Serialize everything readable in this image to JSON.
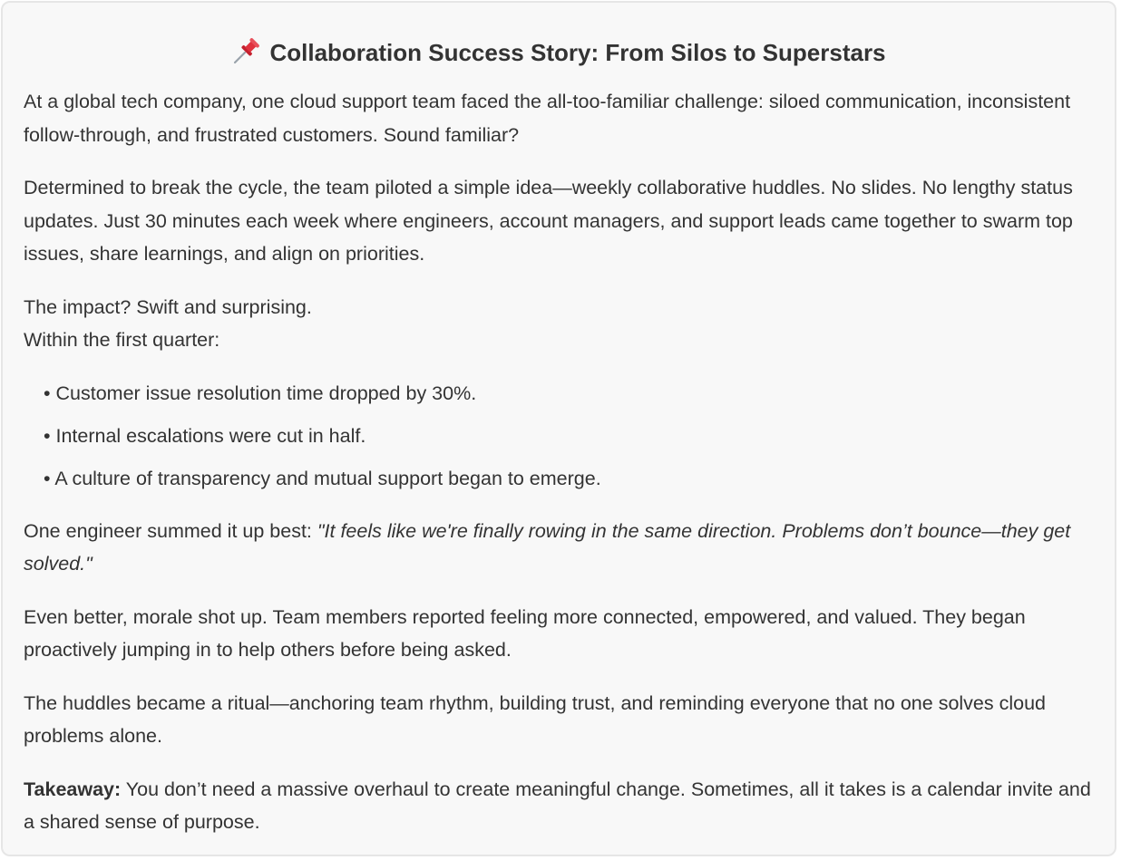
{
  "title": {
    "emoji_icon": "pushpin-icon",
    "text": "Collaboration Success Story: From Silos to Superstars"
  },
  "paragraphs": {
    "intro": "At a global tech company, one cloud support team faced the all-too-familiar challenge: siloed communication, inconsistent follow-through, and frustrated customers. Sound familiar?",
    "idea": "Determined to break the cycle, the team piloted a simple idea—weekly collaborative huddles. No slides. No lengthy status updates. Just 30 minutes each week where engineers, account managers, and support leads came together to swarm top issues, share learnings, and align on priorities.",
    "impact_line1": "The impact? Swift and surprising.",
    "impact_line2": "Within the first quarter:",
    "quote_lead": "One engineer summed it up best: ",
    "quote": "\"It feels like we're finally rowing in the same direction. Problems don’t bounce—they get solved.\"",
    "morale": "Even better, morale shot up. Team members reported feeling more connected, empowered, and valued. They began proactively jumping in to help others before being asked.",
    "ritual": "The huddles became a ritual—anchoring team rhythm, building trust, and reminding everyone that no one solves cloud problems alone.",
    "takeaway_label": "Takeaway:",
    "takeaway_text": " You don’t need a massive overhaul to create meaningful change. Sometimes, all it takes is a calendar invite and a shared sense of purpose."
  },
  "results": [
    "• Customer issue resolution time dropped by 30%.",
    "• Internal escalations were cut in half.",
    "• A culture of transparency and mutual support began to emerge."
  ],
  "colors": {
    "text": "#333333",
    "card_background": "#f8f8f8",
    "card_border": "#e6e6e6",
    "pin_red": "#e0313e"
  }
}
